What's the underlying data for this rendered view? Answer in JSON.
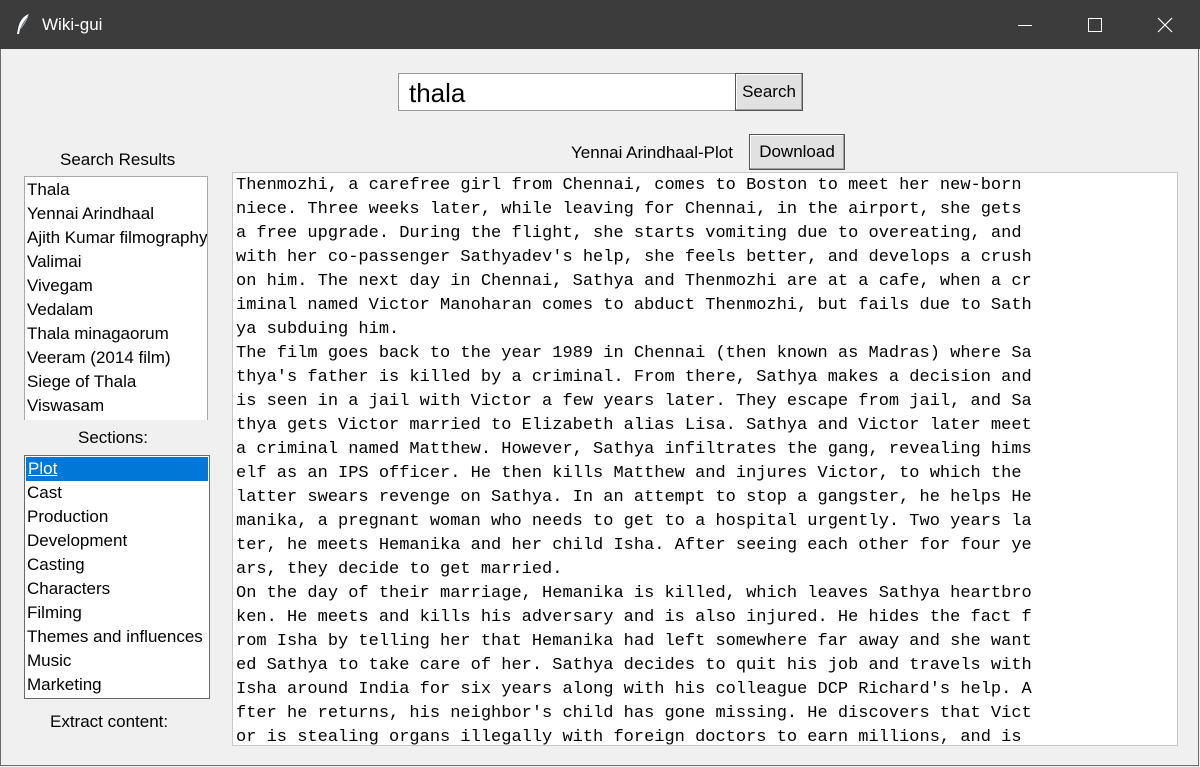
{
  "window": {
    "title": "Wiki-gui",
    "icon": "feather-icon"
  },
  "search": {
    "value": "thala",
    "button_label": "Search"
  },
  "results": {
    "label": "Search Results",
    "items": [
      "Thala",
      "Yennai Arindhaal",
      "Ajith Kumar filmography",
      "Valimai",
      "Vivegam",
      "Vedalam",
      "Thala minagaorum",
      "Veeram (2014 film)",
      "Siege of Thala",
      "Viswasam"
    ]
  },
  "sections": {
    "label": "Sections:",
    "selected": "Plot",
    "items": [
      "Plot",
      "Cast",
      "Production",
      "Development",
      "Casting",
      "Characters",
      "Filming",
      "Themes and influences",
      "Music",
      "Marketing"
    ]
  },
  "extract": {
    "label": "Extract content:"
  },
  "article": {
    "heading": "Yennai Arindhaal-Plot",
    "download_label": "Download",
    "lines": [
      "Thenmozhi, a carefree girl from Chennai, comes to Boston to meet her new-born",
      "niece. Three weeks later, while leaving for Chennai, in the airport, she gets",
      "a free upgrade. During the flight, she starts vomiting due to overeating, and",
      "with her co-passenger Sathyadev's help, she feels better, and develops a crush",
      "on him. The next day in Chennai, Sathya and Thenmozhi are at a cafe, when a cr",
      "iminal named Victor Manoharan comes to abduct Thenmozhi, but fails due to Sath",
      "ya subduing him.",
      "The film goes back to the year 1989 in Chennai (then known as Madras) where Sa",
      "thya's father is killed by a criminal. From there, Sathya makes a decision and",
      "is seen in a jail with Victor a few years later. They escape from jail, and Sa",
      "thya gets Victor married to Elizabeth alias Lisa. Sathya and Victor later meet",
      "a criminal named Matthew. However, Sathya infiltrates the gang, revealing hims",
      "elf as an IPS officer. He then kills Matthew and injures Victor, to which the",
      "latter swears revenge on Sathya. In an attempt to stop a gangster, he helps He",
      "manika, a pregnant woman who needs to get to a hospital urgently. Two years la",
      "ter, he meets Hemanika and her child Isha. After seeing each other for four ye",
      "ars, they decide to get married.",
      "On the day of their marriage, Hemanika is killed, which leaves Sathya heartbro",
      "ken. He meets and kills his adversary and is also injured. He hides the fact f",
      "rom Isha by telling her that Hemanika had left somewhere far away and she want",
      "ed Sathya to take care of her. Sathya decides to quit his job and travels with",
      "Isha around India for six years along with his colleague DCP Richard's help. A",
      "fter he returns, his neighbor's child has gone missing. He discovers that Vict",
      "or is stealing organs illegally with foreign doctors to earn millions, and is"
    ]
  }
}
